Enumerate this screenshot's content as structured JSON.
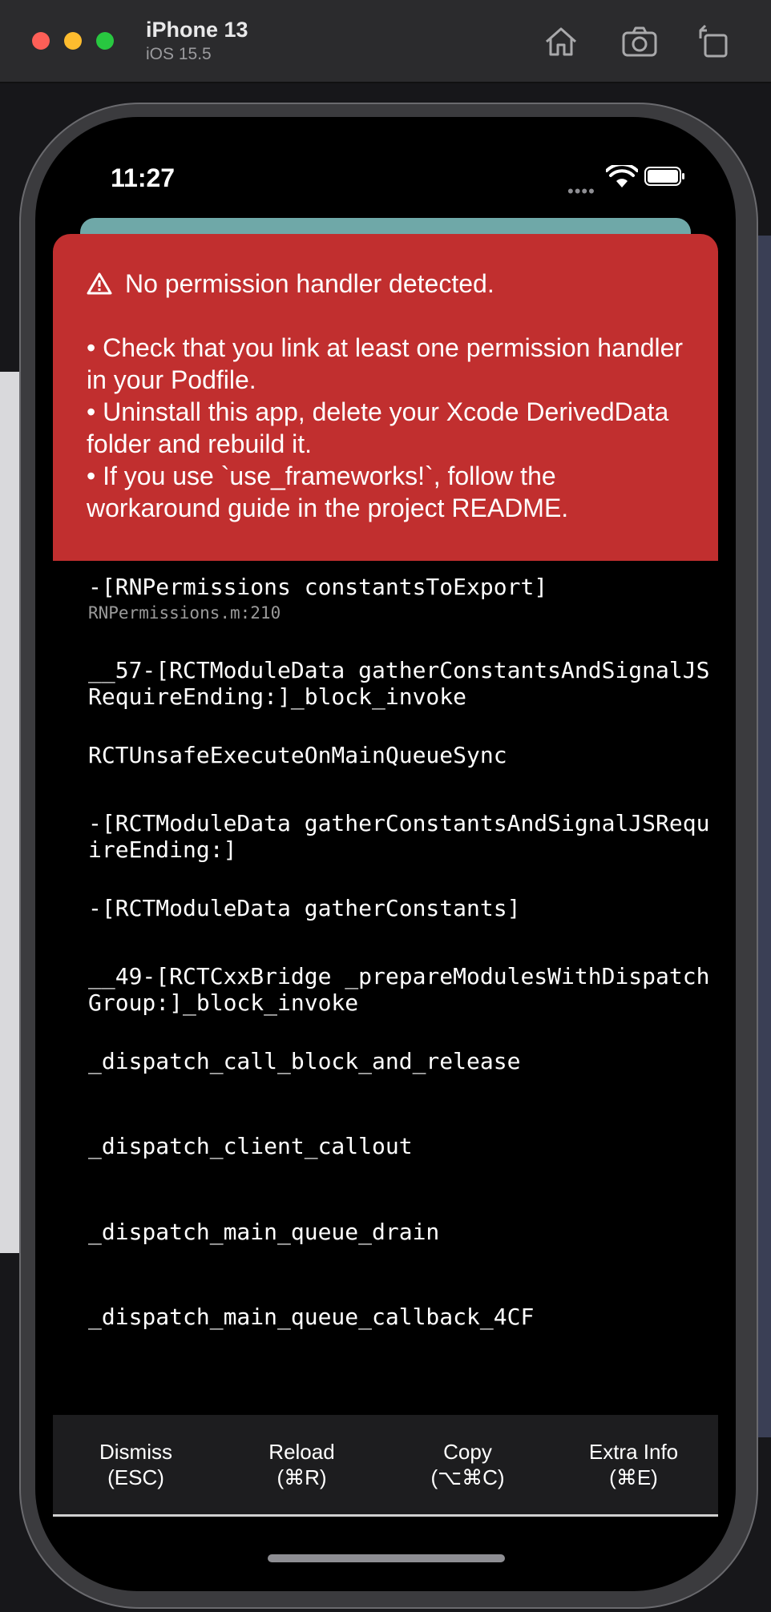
{
  "simulator": {
    "device_name": "iPhone 13",
    "os_version": "iOS 15.5",
    "toolbar_icons": [
      "home-icon",
      "screenshot-icon",
      "rotate-icon"
    ]
  },
  "status_bar": {
    "time": "11:27",
    "dots": "••••"
  },
  "error": {
    "title": "No permission handler detected.",
    "body": "• Check that you link at least one permission handler in your Podfile.\n• Uninstall this app, delete your Xcode DerivedData folder and rebuild it.\n• If you use `use_frameworks!`, follow the workaround guide in the project README.",
    "header_color": "#c12f2f"
  },
  "stack": [
    {
      "method": "-[RNPermissions constantsToExport]",
      "file": "RNPermissions.m:210"
    },
    {
      "method": "__57-[RCTModuleData gatherConstantsAndSignalJSRequireEnding:]_block_invoke"
    },
    {
      "method": "RCTUnsafeExecuteOnMainQueueSync"
    },
    {
      "method": "-[RCTModuleData gatherConstantsAndSignalJSRequireEnding:]"
    },
    {
      "method": "-[RCTModuleData gatherConstants]"
    },
    {
      "method": "__49-[RCTCxxBridge _prepareModulesWithDispatchGroup:]_block_invoke"
    },
    {
      "method": "_dispatch_call_block_and_release"
    },
    {
      "method": "_dispatch_client_callout"
    },
    {
      "method": "_dispatch_main_queue_drain"
    },
    {
      "method": "_dispatch_main_queue_callback_4CF"
    }
  ],
  "footer": {
    "dismiss": {
      "label": "Dismiss",
      "shortcut": "(ESC)"
    },
    "reload": {
      "label": "Reload",
      "shortcut": "(⌘R)"
    },
    "copy": {
      "label": "Copy",
      "shortcut": "(⌥⌘C)"
    },
    "extra": {
      "label": "Extra Info",
      "shortcut": "(⌘E)"
    }
  }
}
